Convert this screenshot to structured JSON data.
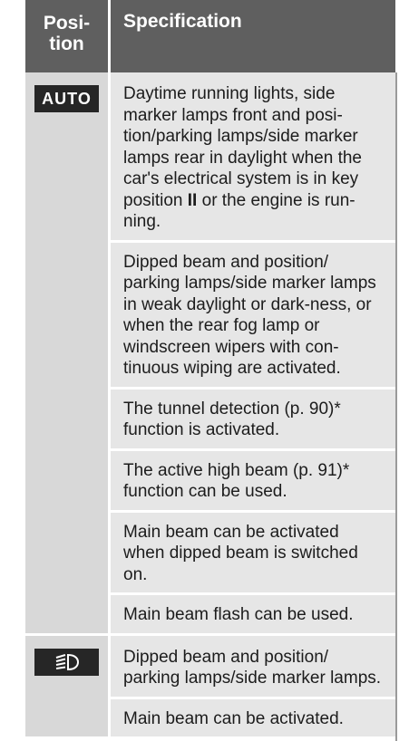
{
  "header": {
    "position": "Posi-\ntion",
    "specification": "Specification"
  },
  "rows": [
    {
      "symbol": "AUTO",
      "paragraphs": [
        [
          "Daytime running lights, side marker lamps front and posi-tion/parking lamps/side marker lamps rear in daylight when the car's electrical system is in key position ",
          "II",
          " or the engine is run-ning."
        ],
        [
          "Dipped beam and position/ parking lamps/side marker lamps in weak daylight or dark-ness, or when the rear fog lamp or windscreen wipers with con-tinuous wiping are activated."
        ],
        [
          "The tunnel detection (p. 90)* function is activated."
        ],
        [
          "The active high beam (p. 91)* function can be used."
        ],
        [
          "Main beam can be activated when dipped beam is switched on."
        ],
        [
          "Main beam flash can be used."
        ]
      ]
    },
    {
      "symbol_icon": "dipped-beam-icon",
      "paragraphs": [
        [
          "Dipped beam and position/ parking lamps/side marker lamps."
        ],
        [
          "Main beam can be activated."
        ]
      ]
    }
  ]
}
